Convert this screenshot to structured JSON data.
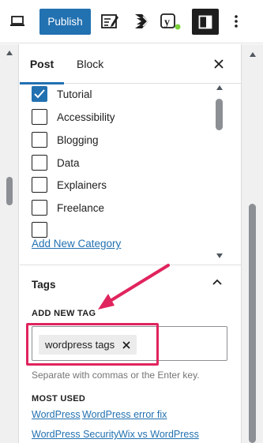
{
  "toolbar": {
    "publish_label": "Publish",
    "icons": [
      "view-icon",
      "edit-mode-icon",
      "performance-icon",
      "yoast-icon",
      "sidebar-toggle-icon",
      "more-options-icon"
    ],
    "yoast_letter": "y",
    "colors": {
      "primary": "#2271b1",
      "dark": "#1e1e1e",
      "yoast_status": "#7ad03a"
    }
  },
  "sidebar": {
    "tabs": [
      {
        "label": "Post",
        "active": true
      },
      {
        "label": "Block",
        "active": false
      }
    ],
    "categories": {
      "items": [
        {
          "label": "Tutorial",
          "checked": true
        },
        {
          "label": "Accessibility",
          "checked": false
        },
        {
          "label": "Blogging",
          "checked": false
        },
        {
          "label": "Data",
          "checked": false
        },
        {
          "label": "Explainers",
          "checked": false
        },
        {
          "label": "Freelance",
          "checked": false
        }
      ],
      "add_new_label": "Add New Category"
    },
    "tags": {
      "title": "Tags",
      "add_new_label": "ADD NEW TAG",
      "current_tags": [
        "wordpress tags"
      ],
      "help_text": "Separate with commas or the Enter key.",
      "most_used_label": "MOST USED",
      "most_used": [
        "WordPress",
        "WordPress error fix",
        "WordPress Security",
        "Wix vs WordPress"
      ]
    }
  },
  "annotation": {
    "color": "#e0245e"
  }
}
